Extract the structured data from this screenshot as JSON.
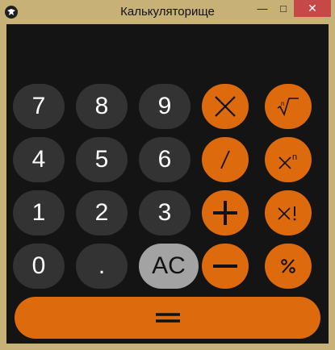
{
  "window": {
    "title": "Калькуляторище"
  },
  "titlebar": {
    "min_symbol": "—",
    "max_symbol": "□",
    "close_symbol": "✕"
  },
  "keys": {
    "n7": "7",
    "n8": "8",
    "n9": "9",
    "n4": "4",
    "n5": "5",
    "n6": "6",
    "n1": "1",
    "n2": "2",
    "n3": "3",
    "n0": "0",
    "dot": ".",
    "ac": "AC"
  },
  "operators": {
    "multiply": "multiply-icon",
    "sqrt": "sqrt-icon",
    "divide": "divide-icon",
    "power": "power-icon",
    "plus": "plus-icon",
    "factorial": "factorial-icon",
    "minus": "minus-icon",
    "percent": "percent-icon",
    "equals": "equals-icon"
  },
  "colors": {
    "accent": "#de6a0e",
    "digit_key": "#333333",
    "ac_key": "#a3a3a3",
    "background": "#141414",
    "frame": "#c8b177"
  }
}
